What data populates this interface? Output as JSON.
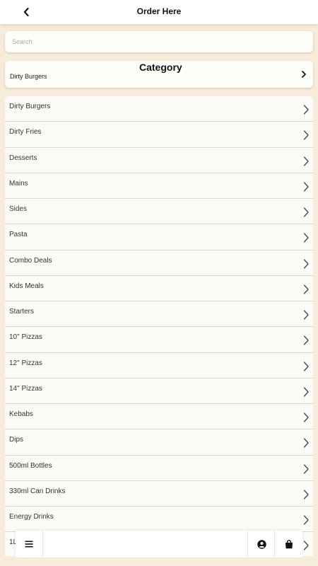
{
  "header": {
    "back_icon": "chevron-left-icon",
    "title": "Order Here"
  },
  "search": {
    "placeholder": "Search",
    "value": ""
  },
  "category": {
    "heading": "Category",
    "selected": "Dirty Burgers",
    "chevron_icon": "chevron-right-icon"
  },
  "categories": [
    "Dirty Burgers",
    "Dirty Fries",
    "Desserts",
    "Mains",
    "Sides",
    "Pasta",
    "Combo Deals",
    "Kids Meals",
    "Starters",
    "10\" Pizzas",
    "12\" Pizzas",
    "14\" Pizzas",
    "Kebabs",
    "Dips",
    "500ml Bottles",
    "330ml Can Drinks",
    "Energy Drinks",
    "1L"
  ],
  "bottom_bar": {
    "menu_icon": "hamburger-menu-icon",
    "account_icon": "account-circle-icon",
    "cart_icon": "shopping-bag-icon"
  },
  "colors": {
    "background": "#f7ebd9",
    "card": "#fdfbf8",
    "text": "#333333"
  }
}
